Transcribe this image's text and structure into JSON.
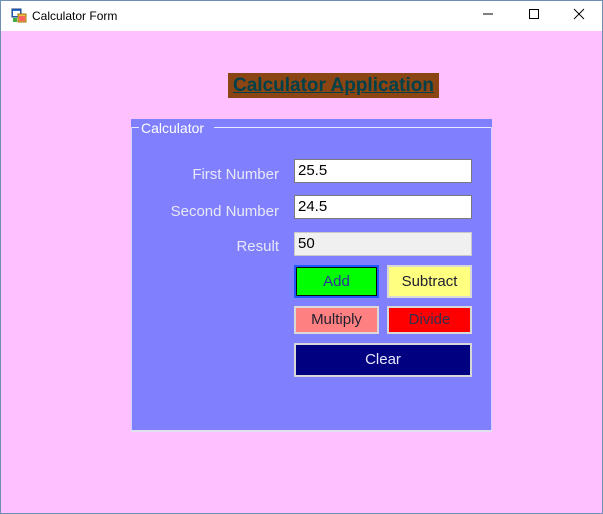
{
  "window": {
    "title": "Calculator Form",
    "icons": {
      "app": "app-form-icon",
      "minimize": "minimize-icon",
      "maximize": "maximize-icon",
      "close": "close-icon"
    }
  },
  "main": {
    "heading": "Calculator Application",
    "group": {
      "title": "Calculator",
      "fields": {
        "first_label": "First Number",
        "first_value": "25.5",
        "second_label": "Second Number",
        "second_value": "24.5",
        "result_label": "Result",
        "result_value": "50"
      },
      "buttons": {
        "add": "Add",
        "subtract": "Subtract",
        "multiply": "Multiply",
        "divide": "Divide",
        "clear": "Clear"
      }
    }
  },
  "colors": {
    "form_background": "#ffc0ff",
    "group_background": "#8080ff",
    "heading_background": "#8b4513",
    "heading_text": "#00404a",
    "add_button": "#00ff00",
    "subtract_button": "#ffff80",
    "multiply_button": "#ff8080",
    "divide_button": "#ff0000",
    "clear_button": "#000080"
  }
}
